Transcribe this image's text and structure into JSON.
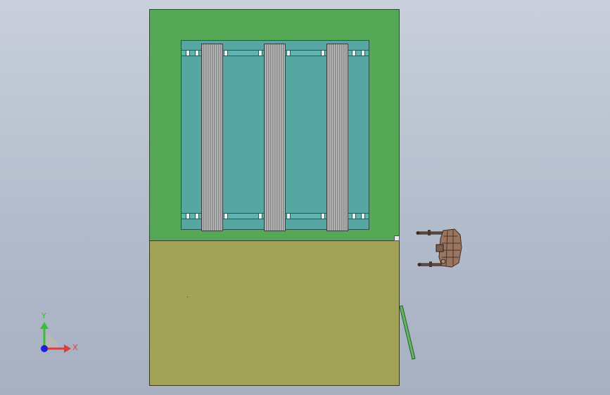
{
  "viewport": {
    "background_top": "#c9d0dc",
    "background_bottom": "#a7b0c1"
  },
  "model": {
    "upper_panel_color": "#55a855",
    "lower_panel_color": "#a2a356",
    "pool_color": "#56a6a2",
    "beam_color": "#9c9c9c",
    "beam_count": 3,
    "stick_color": "#5fb85f",
    "robot_color": "#8a6a55"
  },
  "triad": {
    "y_label": "Y",
    "x_label": "X",
    "y_color": "#38c038",
    "x_color": "#e03c3c",
    "z_color": "#2020d8"
  }
}
